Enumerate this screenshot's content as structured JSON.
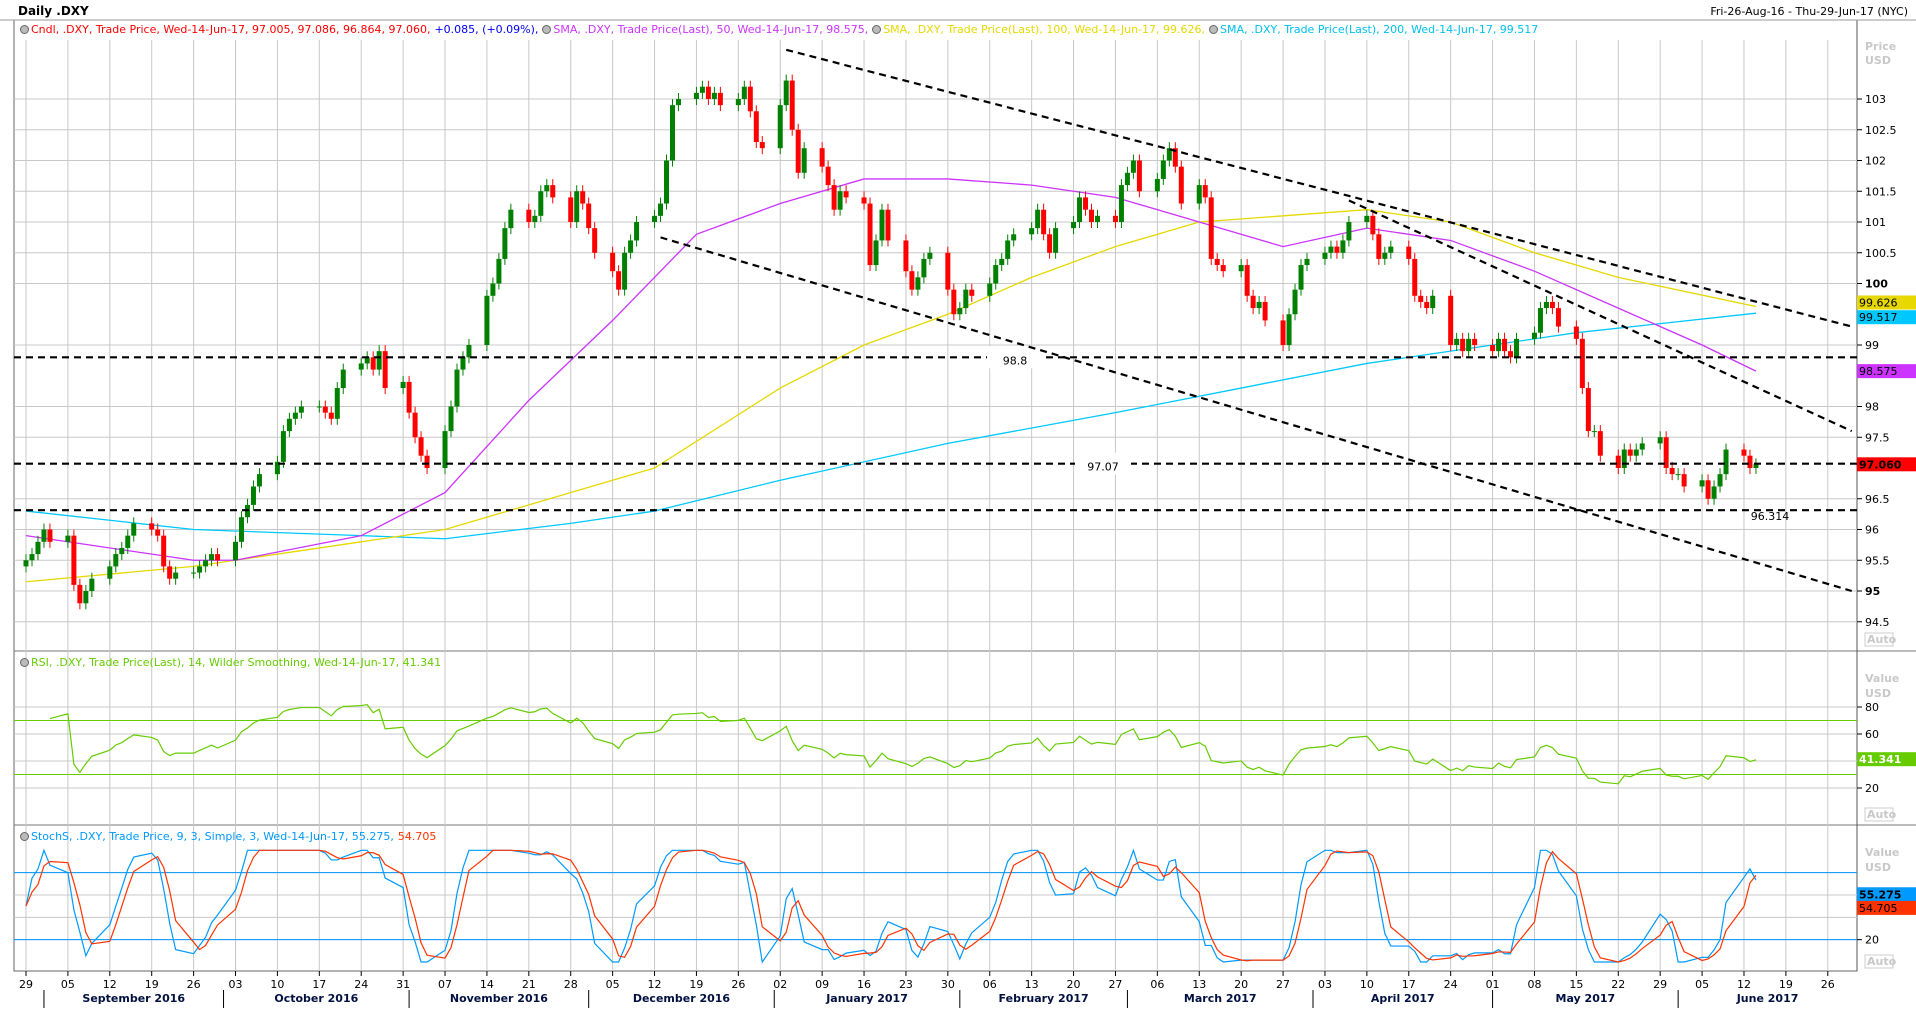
{
  "header": {
    "title": "Daily .DXY",
    "date_range": "Fri-26-Aug-16 - Thu-29-Jun-17 (NYC)"
  },
  "legends": {
    "price": [
      {
        "text": "Cndl, .DXY, Trade Price, Wed-14-Jun-17, 97.005, 97.086, 96.864, 97.060,",
        "color": "#ff0000",
        "icon": "clock-icon"
      },
      {
        "text": "+0.085, (+0.09%),",
        "color": "#0000ff"
      },
      {
        "text": "SMA, .DXY, Trade Price(Last),  50, Wed-14-Jun-17, 98.575,",
        "color": "#cc33ff",
        "icon": "clock-icon"
      },
      {
        "text": "SMA, .DXY, Trade Price(Last),  100, Wed-14-Jun-17, 99.626,",
        "color": "#e6d800",
        "icon": "clock-icon"
      },
      {
        "text": "SMA, .DXY, Trade Price(Last),  200, Wed-14-Jun-17, 99.517",
        "color": "#00c0f0",
        "icon": "clock-icon"
      }
    ],
    "rsi": [
      {
        "text": "RSI, .DXY, Trade Price(Last),  14, Wilder Smoothing, Wed-14-Jun-17, 41.341",
        "color": "#66cc00",
        "icon": "clock-icon"
      }
    ],
    "stoch": [
      {
        "text": "StochS, .DXY, Trade Price,  9, 3, Simple, 3, Wed-14-Jun-17, 55.275,",
        "color": "#0099ff",
        "icon": "clock-icon"
      },
      {
        "text": "54.705",
        "color": "#ff3300"
      }
    ]
  },
  "axes": {
    "price_unit": [
      "Price",
      "USD"
    ],
    "value_unit": [
      "Value",
      "USD"
    ],
    "auto_label": "Auto",
    "price_ticks": [
      "103",
      "102.5",
      "102",
      "101.5",
      "101",
      "100.5",
      "100",
      "99",
      "98",
      "97.5",
      "96.5",
      "96",
      "95.5",
      "95",
      "94.5"
    ],
    "rsi_ticks": [
      "80",
      "60",
      "20"
    ],
    "stoch_ticks": [
      "20"
    ],
    "day_ticks": [
      {
        "date": "2016-08-29",
        "label": "29"
      },
      {
        "date": "2016-09-05",
        "label": "05"
      },
      {
        "date": "2016-09-12",
        "label": "12"
      },
      {
        "date": "2016-09-19",
        "label": "19"
      },
      {
        "date": "2016-09-26",
        "label": "26"
      },
      {
        "date": "2016-10-03",
        "label": "03"
      },
      {
        "date": "2016-10-10",
        "label": "10"
      },
      {
        "date": "2016-10-17",
        "label": "17"
      },
      {
        "date": "2016-10-24",
        "label": "24"
      },
      {
        "date": "2016-10-31",
        "label": "31"
      },
      {
        "date": "2016-11-07",
        "label": "07"
      },
      {
        "date": "2016-11-14",
        "label": "14"
      },
      {
        "date": "2016-11-21",
        "label": "21"
      },
      {
        "date": "2016-11-28",
        "label": "28"
      },
      {
        "date": "2016-12-05",
        "label": "05"
      },
      {
        "date": "2016-12-12",
        "label": "12"
      },
      {
        "date": "2016-12-19",
        "label": "19"
      },
      {
        "date": "2016-12-26",
        "label": "26"
      },
      {
        "date": "2017-01-02",
        "label": "02"
      },
      {
        "date": "2017-01-09",
        "label": "09"
      },
      {
        "date": "2017-01-16",
        "label": "16"
      },
      {
        "date": "2017-01-23",
        "label": "23"
      },
      {
        "date": "2017-01-30",
        "label": "30"
      },
      {
        "date": "2017-02-06",
        "label": "06"
      },
      {
        "date": "2017-02-13",
        "label": "13"
      },
      {
        "date": "2017-02-20",
        "label": "20"
      },
      {
        "date": "2017-02-27",
        "label": "27"
      },
      {
        "date": "2017-03-06",
        "label": "06"
      },
      {
        "date": "2017-03-13",
        "label": "13"
      },
      {
        "date": "2017-03-20",
        "label": "20"
      },
      {
        "date": "2017-03-27",
        "label": "27"
      },
      {
        "date": "2017-04-03",
        "label": "03"
      },
      {
        "date": "2017-04-10",
        "label": "10"
      },
      {
        "date": "2017-04-17",
        "label": "17"
      },
      {
        "date": "2017-04-24",
        "label": "24"
      },
      {
        "date": "2017-05-01",
        "label": "01"
      },
      {
        "date": "2017-05-08",
        "label": "08"
      },
      {
        "date": "2017-05-15",
        "label": "15"
      },
      {
        "date": "2017-05-22",
        "label": "22"
      },
      {
        "date": "2017-05-29",
        "label": "29"
      },
      {
        "date": "2017-06-05",
        "label": "05"
      },
      {
        "date": "2017-06-12",
        "label": "12"
      },
      {
        "date": "2017-06-19",
        "label": "19"
      },
      {
        "date": "2017-06-26",
        "label": "26"
      }
    ],
    "months": [
      {
        "start": "2016-09-01",
        "end": "2016-10-01",
        "label": "September 2016"
      },
      {
        "start": "2016-10-01",
        "end": "2016-11-01",
        "label": "October 2016"
      },
      {
        "start": "2016-11-01",
        "end": "2016-12-01",
        "label": "November 2016"
      },
      {
        "start": "2016-12-01",
        "end": "2017-01-01",
        "label": "December 2016"
      },
      {
        "start": "2017-01-01",
        "end": "2017-02-01",
        "label": "January 2017"
      },
      {
        "start": "2017-02-01",
        "end": "2017-03-01",
        "label": "February 2017"
      },
      {
        "start": "2017-03-01",
        "end": "2017-04-01",
        "label": "March 2017"
      },
      {
        "start": "2017-04-01",
        "end": "2017-05-01",
        "label": "April 2017"
      },
      {
        "start": "2017-05-01",
        "end": "2017-06-01",
        "label": "May 2017"
      },
      {
        "start": "2017-06-01",
        "end": "2017-07-01",
        "label": "June 2017"
      }
    ]
  },
  "badges": {
    "sma100": {
      "text": "99.626",
      "value": 99.626,
      "color": "#e6d800"
    },
    "sma200": {
      "text": "99.517",
      "value": 99.517,
      "color": "#00c8ff"
    },
    "sma50": {
      "text": "98.575",
      "value": 98.575,
      "color": "#cc33ff"
    },
    "last": {
      "text": "97.060",
      "value": 97.06,
      "color": "#ff0000"
    },
    "rsi": {
      "text": "41.341",
      "value": 41.341,
      "color": "#66cc00"
    },
    "stoch_k": {
      "text": "55.275",
      "value": 55.275,
      "color": "#0099ff"
    },
    "stoch_d": {
      "text": "54.705",
      "value": 54.705,
      "color": "#ff3300"
    }
  },
  "annotations": {
    "h_lines": [
      {
        "value": 98.8,
        "label": "98.8"
      },
      {
        "value": 97.07,
        "label": "97.07"
      },
      {
        "value": 96.314,
        "label": "96.314"
      }
    ],
    "trend_lines": [
      {
        "from": [
          "2017-01-03",
          103.8
        ],
        "to": [
          "2017-06-30",
          99.3
        ]
      },
      {
        "from": [
          "2016-12-13",
          100.75
        ],
        "to": [
          "2017-06-30",
          95.0
        ]
      },
      {
        "from": [
          "2017-04-07",
          101.35
        ],
        "to": [
          "2017-06-30",
          97.6
        ]
      }
    ]
  },
  "chart_data": {
    "type": "candlestick",
    "symbol": ".DXY",
    "interval": "Daily",
    "ylim": [
      94.2,
      104.0
    ],
    "grid": true,
    "colors": {
      "up": "#008000",
      "down": "#ff0000",
      "sma50": "#cc33ff",
      "sma100": "#e6d800",
      "sma200": "#00c8ff",
      "rsi": "#66cc00",
      "stoch_k": "#0099ff",
      "stoch_d": "#ff3300",
      "rsi_bands": "#66cc00",
      "stoch_bands": "#0099ff"
    },
    "weekly_closes": [
      {
        "week": "2016-08-29",
        "closes": [
          95.5,
          95.6,
          95.8,
          96.0,
          95.8
        ]
      },
      {
        "week": "2016-09-05",
        "closes": [
          95.9,
          95.1,
          94.8,
          95.0,
          95.2
        ]
      },
      {
        "week": "2016-09-12",
        "closes": [
          95.4,
          95.6,
          95.7,
          95.9,
          96.1
        ]
      },
      {
        "week": "2016-09-19",
        "closes": [
          96.0,
          95.9,
          95.4,
          95.2,
          95.3
        ]
      },
      {
        "week": "2016-09-26",
        "closes": [
          95.3,
          95.4,
          95.5,
          95.6,
          95.5
        ]
      },
      {
        "week": "2016-10-03",
        "closes": [
          95.8,
          96.2,
          96.4,
          96.7,
          96.9
        ]
      },
      {
        "week": "2016-10-10",
        "closes": [
          97.1,
          97.6,
          97.8,
          97.9,
          98.0
        ]
      },
      {
        "week": "2016-10-17",
        "closes": [
          98.0,
          97.9,
          97.8,
          98.3,
          98.6
        ]
      },
      {
        "week": "2016-10-24",
        "closes": [
          98.7,
          98.8,
          98.6,
          98.9,
          98.3
        ]
      },
      {
        "week": "2016-10-31",
        "closes": [
          98.4,
          97.9,
          97.5,
          97.2,
          97.0
        ]
      },
      {
        "week": "2016-11-07",
        "closes": [
          97.6,
          98.0,
          98.6,
          98.8,
          99.0
        ]
      },
      {
        "week": "2016-11-14",
        "closes": [
          99.8,
          100.0,
          100.4,
          100.9,
          101.2
        ]
      },
      {
        "week": "2016-11-21",
        "closes": [
          101.0,
          101.1,
          101.5,
          101.6,
          101.4
        ]
      },
      {
        "week": "2016-11-28",
        "closes": [
          101.0,
          101.5,
          101.3,
          100.9,
          100.5
        ]
      },
      {
        "week": "2016-12-05",
        "closes": [
          100.2,
          99.9,
          100.5,
          100.7,
          101.0
        ]
      },
      {
        "week": "2016-12-12",
        "closes": [
          101.1,
          101.3,
          102.0,
          102.9,
          103.0
        ]
      },
      {
        "week": "2016-12-19",
        "closes": [
          103.1,
          103.2,
          103.0,
          103.1,
          102.9
        ]
      },
      {
        "week": "2016-12-26",
        "closes": [
          103.0,
          103.2,
          102.8,
          102.3,
          102.2
        ]
      },
      {
        "week": "2017-01-02",
        "closes": [
          102.9,
          103.3,
          102.5,
          101.8,
          102.2
        ]
      },
      {
        "week": "2017-01-09",
        "closes": [
          101.9,
          101.6,
          101.2,
          101.5,
          101.4
        ]
      },
      {
        "week": "2017-01-16",
        "closes": [
          101.3,
          100.3,
          100.7,
          101.2,
          100.7
        ]
      },
      {
        "week": "2017-01-23",
        "closes": [
          100.2,
          99.9,
          100.1,
          100.4,
          100.5
        ]
      },
      {
        "week": "2017-01-30",
        "closes": [
          99.9,
          99.5,
          99.6,
          99.9,
          99.8
        ]
      },
      {
        "week": "2017-02-06",
        "closes": [
          100.0,
          100.3,
          100.4,
          100.7,
          100.8
        ]
      },
      {
        "week": "2017-02-13",
        "closes": [
          100.9,
          101.2,
          100.8,
          100.5,
          100.9
        ]
      },
      {
        "week": "2017-02-20",
        "closes": [
          101.0,
          101.4,
          101.2,
          101.0,
          101.1
        ]
      },
      {
        "week": "2017-02-27",
        "closes": [
          101.0,
          101.6,
          101.8,
          102.0,
          101.5
        ]
      },
      {
        "week": "2017-03-06",
        "closes": [
          101.7,
          102.0,
          102.2,
          101.9,
          101.3
        ]
      },
      {
        "week": "2017-03-13",
        "closes": [
          101.6,
          101.4,
          100.4,
          100.3,
          100.2
        ]
      },
      {
        "week": "2017-03-20",
        "closes": [
          100.3,
          99.8,
          99.6,
          99.7,
          99.4
        ]
      },
      {
        "week": "2017-03-27",
        "closes": [
          99.0,
          99.5,
          99.9,
          100.3,
          100.4
        ]
      },
      {
        "week": "2017-04-03",
        "closes": [
          100.5,
          100.6,
          100.5,
          100.7,
          101.0
        ]
      },
      {
        "week": "2017-04-10",
        "closes": [
          101.1,
          100.8,
          100.4,
          100.5,
          100.6
        ]
      },
      {
        "week": "2017-04-17",
        "closes": [
          100.4,
          99.8,
          99.7,
          99.6,
          99.8
        ]
      },
      {
        "week": "2017-04-24",
        "closes": [
          99.0,
          99.1,
          98.9,
          99.1,
          99.0
        ]
      },
      {
        "week": "2017-05-01",
        "closes": [
          98.9,
          99.1,
          98.9,
          98.8,
          99.1
        ]
      },
      {
        "week": "2017-05-08",
        "closes": [
          99.2,
          99.6,
          99.7,
          99.6,
          99.3
        ]
      },
      {
        "week": "2017-05-15",
        "closes": [
          99.1,
          98.3,
          97.6,
          97.6,
          97.2
        ]
      },
      {
        "week": "2017-05-22",
        "closes": [
          97.0,
          97.3,
          97.2,
          97.3,
          97.4
        ]
      },
      {
        "week": "2017-05-29",
        "closes": [
          97.5,
          97.0,
          96.9,
          96.9,
          96.7
        ]
      },
      {
        "week": "2017-06-05",
        "closes": [
          96.8,
          96.5,
          96.7,
          96.9,
          97.3
        ]
      },
      {
        "week": "2017-06-12",
        "closes": [
          97.2,
          97.0,
          97.06
        ]
      }
    ],
    "sma50": [
      [
        "2016-08-29",
        95.9
      ],
      [
        "2016-09-26",
        95.5
      ],
      [
        "2016-10-03",
        95.5
      ],
      [
        "2016-10-24",
        95.9
      ],
      [
        "2016-11-07",
        96.6
      ],
      [
        "2016-11-21",
        98.1
      ],
      [
        "2016-12-05",
        99.4
      ],
      [
        "2016-12-19",
        100.8
      ],
      [
        "2017-01-02",
        101.3
      ],
      [
        "2017-01-16",
        101.7
      ],
      [
        "2017-01-30",
        101.7
      ],
      [
        "2017-02-13",
        101.6
      ],
      [
        "2017-02-27",
        101.4
      ],
      [
        "2017-03-13",
        101.0
      ],
      [
        "2017-03-27",
        100.6
      ],
      [
        "2017-04-10",
        100.9
      ],
      [
        "2017-04-24",
        100.7
      ],
      [
        "2017-05-08",
        100.2
      ],
      [
        "2017-05-22",
        99.6
      ],
      [
        "2017-06-05",
        99.0
      ],
      [
        "2017-06-14",
        98.575
      ]
    ],
    "sma100": [
      [
        "2016-08-29",
        95.15
      ],
      [
        "2016-09-26",
        95.4
      ],
      [
        "2016-10-24",
        95.8
      ],
      [
        "2016-11-07",
        96.0
      ],
      [
        "2016-12-05",
        96.8
      ],
      [
        "2016-12-12",
        97.0
      ],
      [
        "2017-01-02",
        98.3
      ],
      [
        "2017-01-16",
        99.0
      ],
      [
        "2017-01-30",
        99.5
      ],
      [
        "2017-02-13",
        100.1
      ],
      [
        "2017-02-27",
        100.6
      ],
      [
        "2017-03-13",
        101.0
      ],
      [
        "2017-04-10",
        101.2
      ],
      [
        "2017-04-24",
        101.0
      ],
      [
        "2017-05-08",
        100.5
      ],
      [
        "2017-05-22",
        100.1
      ],
      [
        "2017-06-14",
        99.626
      ]
    ],
    "sma200": [
      [
        "2016-08-29",
        96.3
      ],
      [
        "2016-09-26",
        96.0
      ],
      [
        "2016-10-24",
        95.9
      ],
      [
        "2016-11-07",
        95.85
      ],
      [
        "2016-11-28",
        96.1
      ],
      [
        "2016-12-12",
        96.3
      ],
      [
        "2017-01-02",
        96.8
      ],
      [
        "2017-01-30",
        97.4
      ],
      [
        "2017-02-27",
        97.9
      ],
      [
        "2017-03-20",
        98.3
      ],
      [
        "2017-04-10",
        98.7
      ],
      [
        "2017-04-24",
        98.9
      ],
      [
        "2017-05-15",
        99.2
      ],
      [
        "2017-06-14",
        99.517
      ]
    ],
    "rsi": {
      "period": 14,
      "smoothing": "Wilder",
      "bands": [
        30,
        70
      ],
      "ylim": [
        0,
        100
      ],
      "ticks": [
        20,
        40,
        60,
        80
      ]
    },
    "stoch": {
      "k": 9,
      "smooth": 3,
      "d": 3,
      "bands": [
        20,
        80
      ],
      "ylim": [
        0,
        100
      ],
      "ticks": [
        20,
        40,
        60,
        80
      ]
    }
  }
}
